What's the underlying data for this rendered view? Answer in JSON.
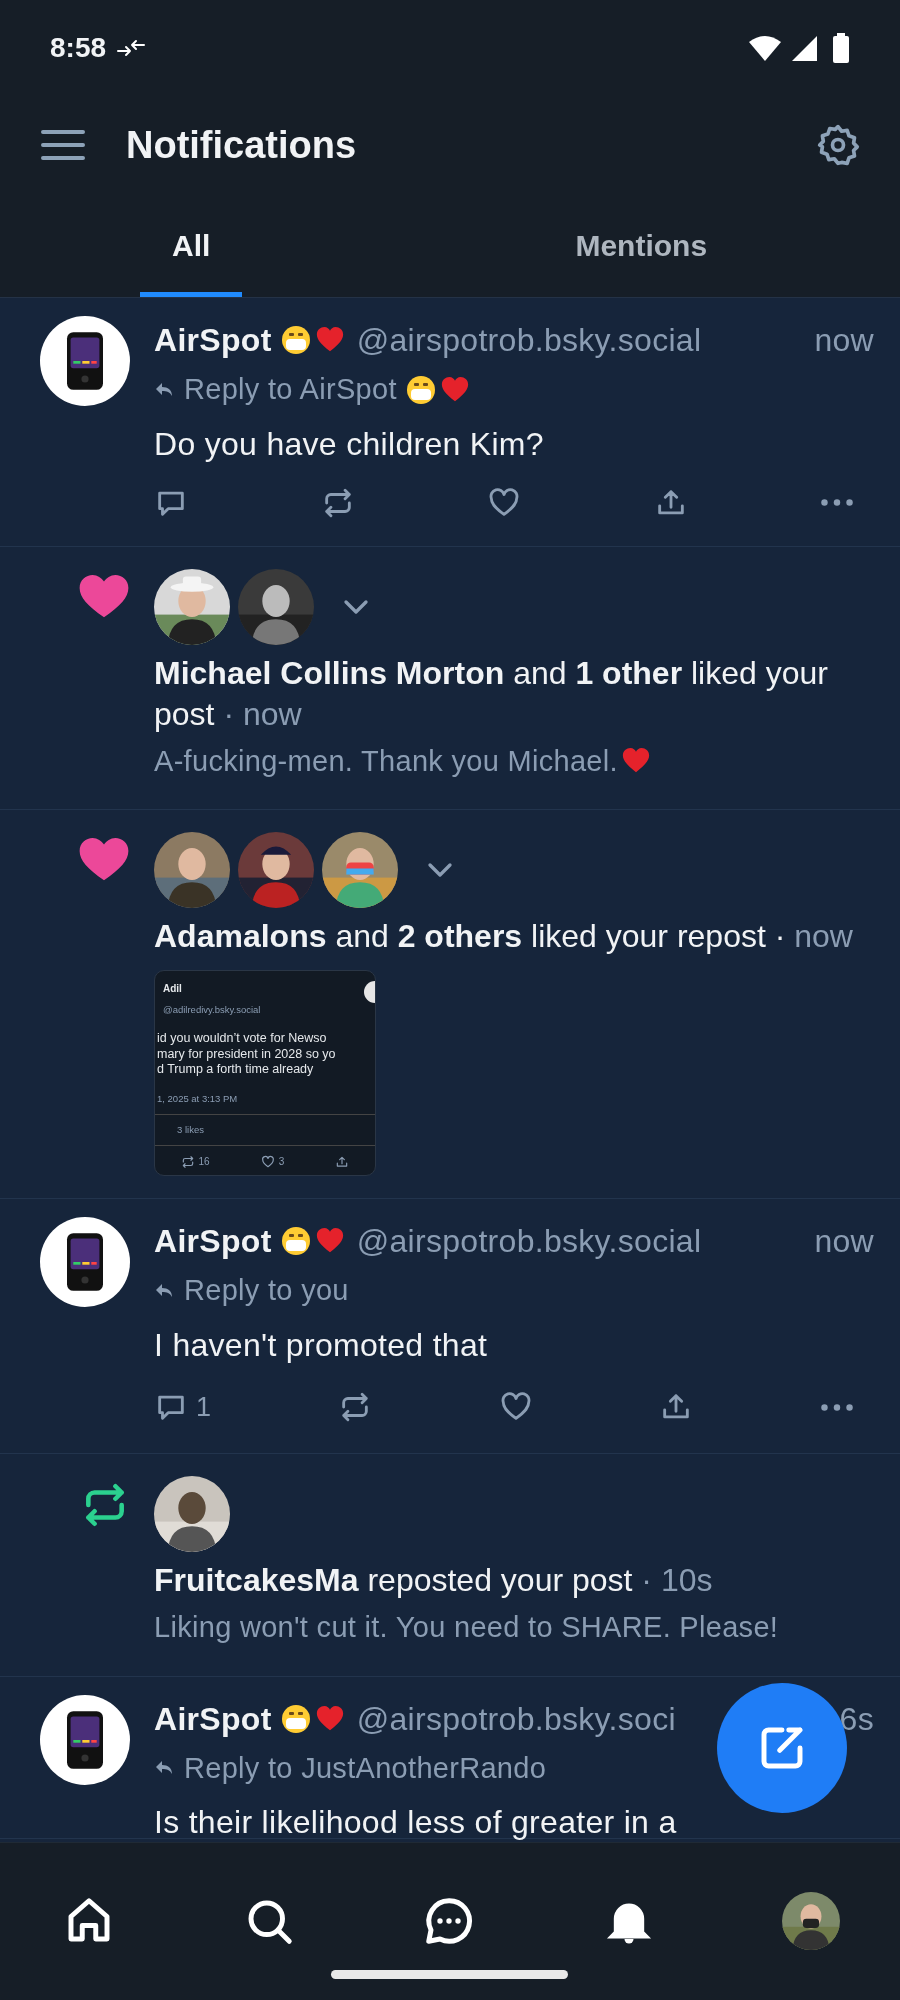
{
  "status_bar": {
    "time": "8:58"
  },
  "header": {
    "title": "Notifications"
  },
  "tabs": [
    {
      "label": "All",
      "selected": true
    },
    {
      "label": "Mentions",
      "selected": false
    }
  ],
  "notifications": [
    {
      "kind": "post",
      "author": "AirSpot",
      "author_emoji": true,
      "handle": "@airspotrob.bsky.social",
      "time": "now",
      "reply_to": "Reply to AirSpot",
      "reply_emoji": true,
      "text": "Do you have children Kim?"
    },
    {
      "kind": "like",
      "expandable": true,
      "summary": "**Michael Collins Morton** and **1 other** liked your post",
      "time": "· now",
      "excerpt": "A-fucking-men. Thank you Michael.",
      "excerpt_heart": true
    },
    {
      "kind": "like",
      "expandable": true,
      "summary": "**Adamalons** and **2 others** liked your repost ·",
      "time": "now",
      "embed": {
        "name": "Adil",
        "handle": "@adilredivy.bsky.social",
        "lines": [
          "id you wouldn’t vote for Newso",
          "mary for president in 2028 so yo",
          "d Trump a forth time already"
        ],
        "date": "1, 2025 at 3:13 PM",
        "likes": "3 likes",
        "reposts": "16",
        "hearts": "3"
      }
    },
    {
      "kind": "post",
      "author": "AirSpot",
      "author_emoji": true,
      "handle": "@airspotrob.bsky.social",
      "time": "now",
      "reply_to": "Reply to you",
      "reply_emoji": false,
      "text": "I haven't promoted that",
      "reply_count": "1"
    },
    {
      "kind": "repost",
      "expandable": false,
      "summary": "**FruitcakesMa** reposted your post",
      "time": "· 10s",
      "excerpt": "Liking won't cut it. You need to SHARE. Please!",
      "excerpt_heart": false
    },
    {
      "kind": "post",
      "author": "AirSpot",
      "author_emoji": true,
      "handle": "@airspotrob.bsky.soci",
      "time": "6s",
      "reply_to": "Reply to JustAnotherRando",
      "reply_emoji": false,
      "text": "Is their likelihood less of greater in a",
      "cut": true
    }
  ],
  "bottom_nav": [
    {
      "kind": "home",
      "selected": false
    },
    {
      "kind": "search",
      "selected": false
    },
    {
      "kind": "chat",
      "selected": false
    },
    {
      "kind": "bell",
      "selected": true
    },
    {
      "kind": "profile",
      "selected": false
    }
  ]
}
